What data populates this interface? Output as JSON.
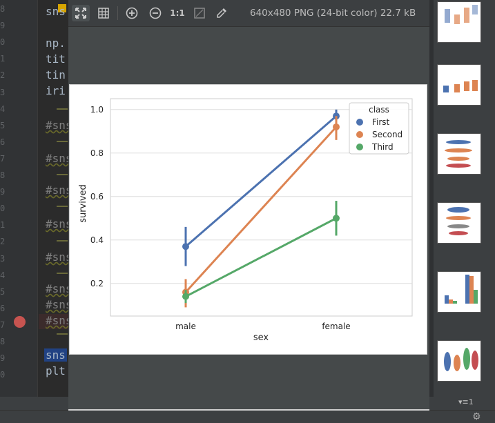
{
  "editor": {
    "line_numbers": [
      "8",
      "9",
      "0",
      "1",
      "2",
      "3",
      "4",
      "5",
      "6",
      "7",
      "8",
      "9",
      "0",
      "1",
      "2",
      "3",
      "4",
      "5",
      "6",
      "7",
      "8",
      "9",
      "0"
    ],
    "lines": [
      {
        "text": "sns",
        "kind": "code"
      },
      {
        "text": "np.",
        "kind": "code"
      },
      {
        "text": "tit",
        "kind": "code"
      },
      {
        "text": "tin",
        "kind": "code"
      },
      {
        "text": "iri",
        "kind": "code"
      },
      {
        "text": "#sns",
        "kind": "comment"
      },
      {
        "text": "#sns",
        "kind": "comment"
      },
      {
        "text": "#sns",
        "kind": "comment"
      },
      {
        "text": "#sns",
        "kind": "comment"
      },
      {
        "text": "#sns",
        "kind": "comment"
      },
      {
        "text": "#sns",
        "kind": "comment"
      },
      {
        "text": "#sns",
        "kind": "comment"
      },
      {
        "text": "#sns",
        "kind": "comment"
      },
      {
        "text": "sns",
        "kind": "selected"
      },
      {
        "text": "plt",
        "kind": "code"
      }
    ]
  },
  "viewer": {
    "toolbar": {
      "fit_icon": "fit-to-window-icon",
      "grid_icon": "grid-icon",
      "zoom_in_icon": "zoom-in-icon",
      "zoom_out_icon": "zoom-out-icon",
      "actual_size_label": "1:1",
      "background_icon": "background-icon",
      "color_picker_icon": "color-picker-icon"
    },
    "image_info": "640x480 PNG (24-bit color) 22.7 kB"
  },
  "thumbnails": {
    "footer_label": "▾≡1"
  },
  "colors": {
    "first": "#4c72b0",
    "second": "#dd8452",
    "third": "#55a868"
  },
  "chart_data": {
    "type": "line",
    "categories": [
      "male",
      "female"
    ],
    "xlabel": "sex",
    "ylabel": "survived",
    "ylim": [
      0.05,
      1.05
    ],
    "yticks": [
      "0.2",
      "0.4",
      "0.6",
      "0.8",
      "1.0"
    ],
    "ytick_values": [
      0.2,
      0.4,
      0.6,
      0.8,
      1.0
    ],
    "grid": true,
    "legend_title": "class",
    "legend_position": "top-right",
    "series": [
      {
        "name": "First",
        "color": "#4c72b0",
        "values": [
          0.37,
          0.97
        ],
        "ci_low": [
          0.28,
          0.93
        ],
        "ci_high": [
          0.46,
          1.0
        ]
      },
      {
        "name": "Second",
        "color": "#dd8452",
        "values": [
          0.16,
          0.92
        ],
        "ci_low": [
          0.09,
          0.86
        ],
        "ci_high": [
          0.22,
          0.97
        ]
      },
      {
        "name": "Third",
        "color": "#55a868",
        "values": [
          0.14,
          0.5
        ],
        "ci_low": [
          0.11,
          0.42
        ],
        "ci_high": [
          0.17,
          0.58
        ]
      }
    ]
  }
}
